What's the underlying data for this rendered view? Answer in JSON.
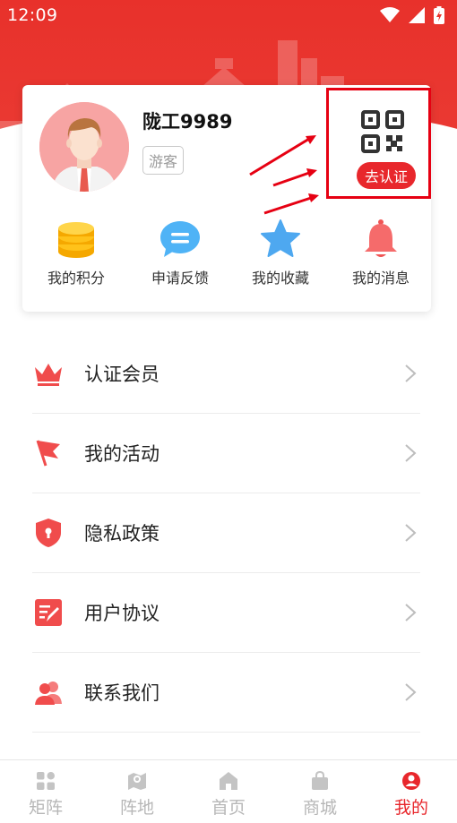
{
  "status_bar": {
    "time": "12:09"
  },
  "profile": {
    "username": "陇工9989",
    "badge": "游客",
    "verify_button": "去认证"
  },
  "quick_actions": [
    {
      "label": "我的积分",
      "icon": "coins-icon"
    },
    {
      "label": "申请反馈",
      "icon": "chat-bubble-icon"
    },
    {
      "label": "我的收藏",
      "icon": "star-icon"
    },
    {
      "label": "我的消息",
      "icon": "bell-icon"
    }
  ],
  "menu": [
    {
      "label": "认证会员",
      "icon": "crown-icon"
    },
    {
      "label": "我的活动",
      "icon": "flag-icon"
    },
    {
      "label": "隐私政策",
      "icon": "shield-icon"
    },
    {
      "label": "用户协议",
      "icon": "document-edit-icon"
    },
    {
      "label": "联系我们",
      "icon": "contacts-icon"
    }
  ],
  "bottom_nav": [
    {
      "label": "矩阵",
      "icon": "grid-icon",
      "active": false
    },
    {
      "label": "阵地",
      "icon": "map-pin-icon",
      "active": false
    },
    {
      "label": "首页",
      "icon": "home-icon",
      "active": false
    },
    {
      "label": "商城",
      "icon": "shopping-bag-icon",
      "active": false
    },
    {
      "label": "我的",
      "icon": "user-icon",
      "active": true
    }
  ],
  "colors": {
    "brand_red": "#e8272c",
    "highlight_red": "#e60012",
    "inactive_gray": "#b7b7b7"
  }
}
